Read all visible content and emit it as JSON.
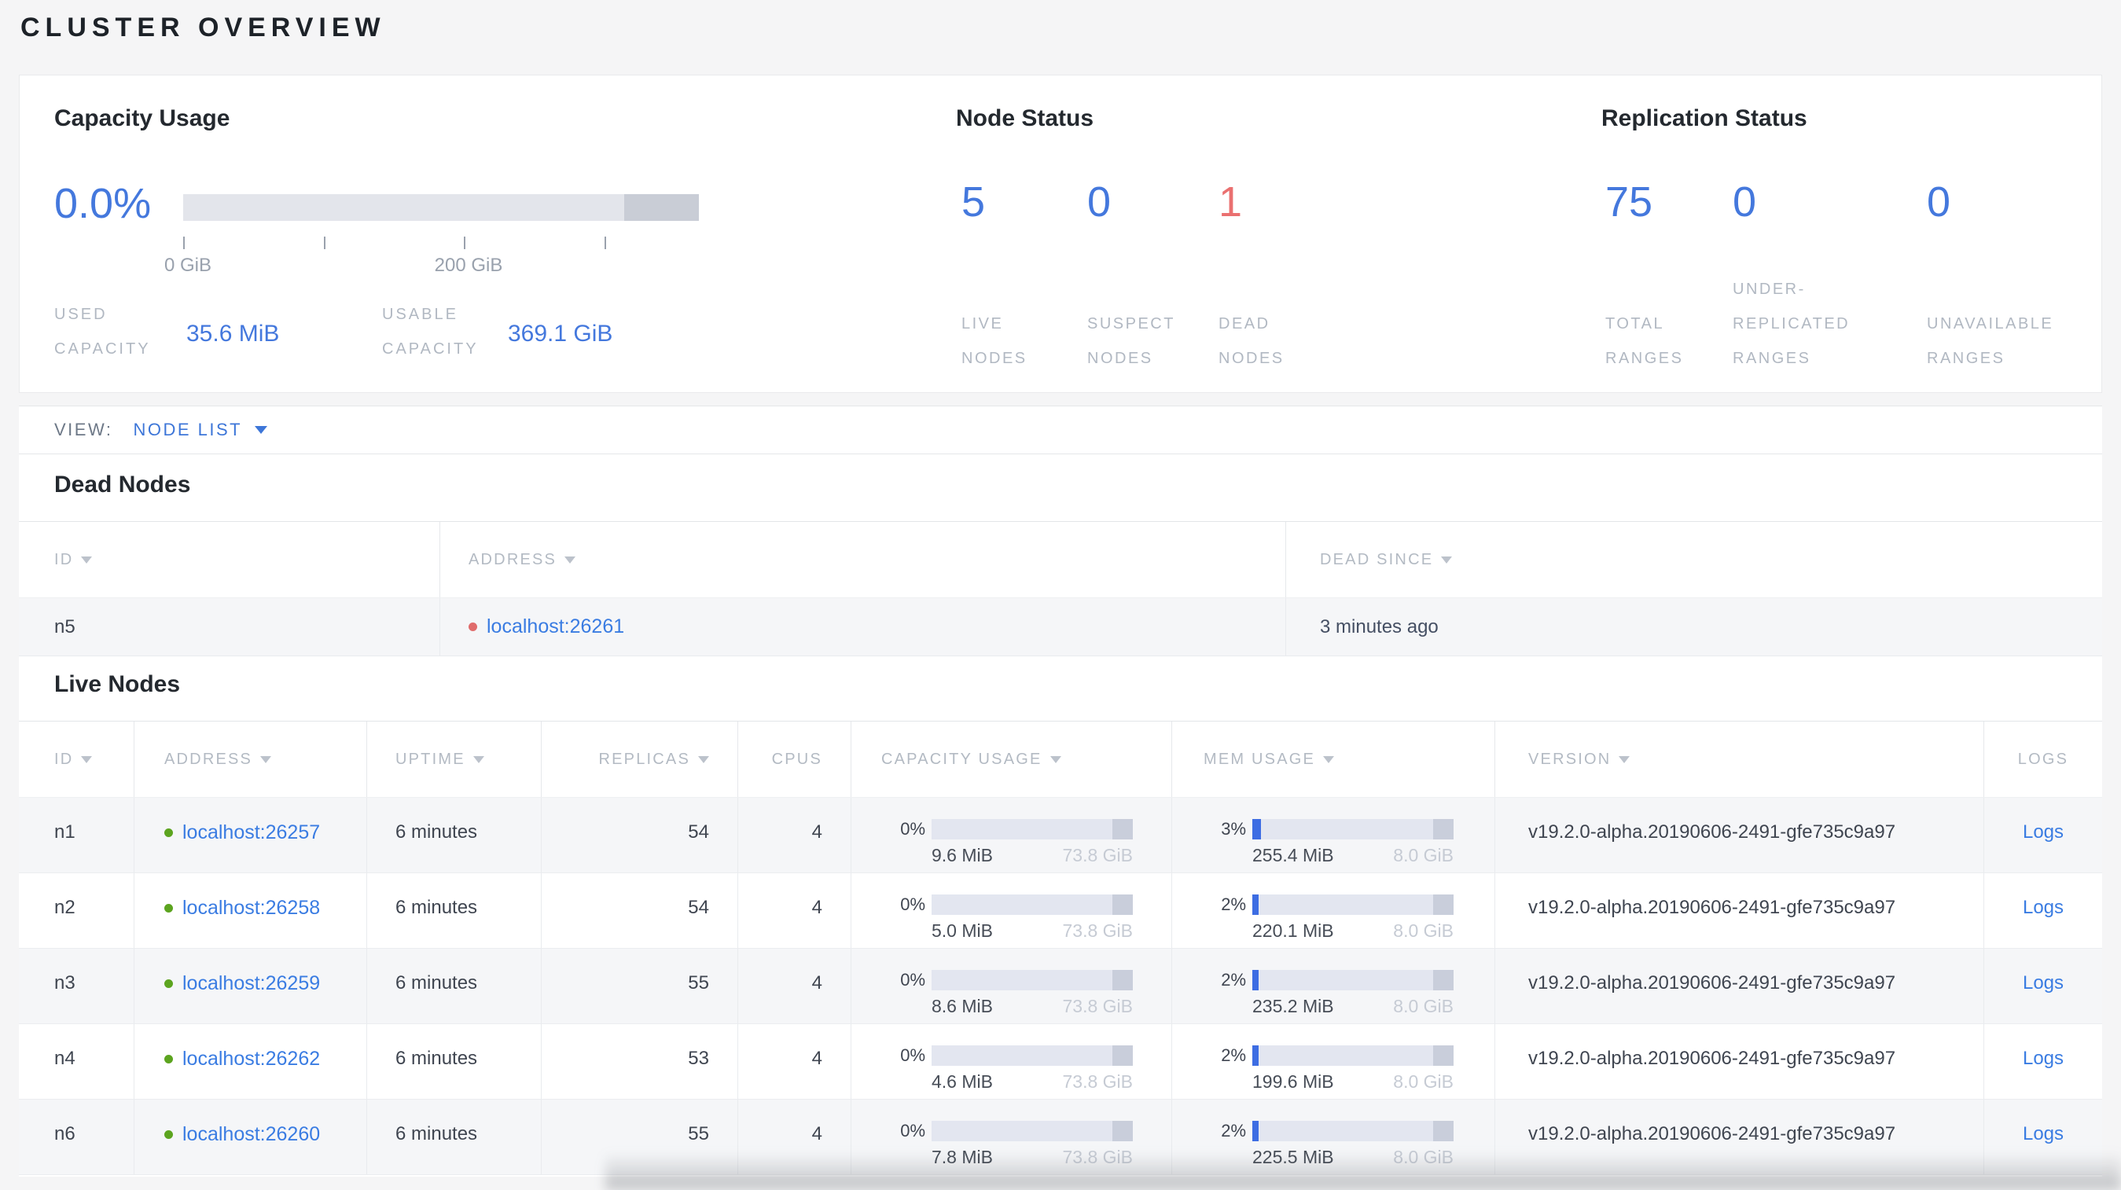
{
  "page_title": "CLUSTER OVERVIEW",
  "summary": {
    "capacity": {
      "title": "Capacity Usage",
      "percent": "0.0%",
      "tick_labels": [
        "0 GiB",
        "200 GiB"
      ],
      "used_label": "USED\nCAPACITY",
      "used_value": "35.6 MiB",
      "usable_label": "USABLE\nCAPACITY",
      "usable_value": "369.1 GiB"
    },
    "node_status": {
      "title": "Node Status",
      "stats": [
        {
          "value": "5",
          "label": "LIVE\nNODES",
          "color": "blue"
        },
        {
          "value": "0",
          "label": "SUSPECT\nNODES",
          "color": "blue"
        },
        {
          "value": "1",
          "label": "DEAD\nNODES",
          "color": "red"
        }
      ]
    },
    "replication": {
      "title": "Replication Status",
      "stats": [
        {
          "value": "75",
          "label": "TOTAL\nRANGES",
          "color": "blue"
        },
        {
          "value": "0",
          "label": "UNDER-\nREPLICATED\nRANGES",
          "color": "blue"
        },
        {
          "value": "0",
          "label": "UNAVAILABLE\nRANGES",
          "color": "blue"
        }
      ]
    }
  },
  "view_bar": {
    "label": "VIEW:",
    "selected": "NODE LIST"
  },
  "dead_nodes": {
    "title": "Dead Nodes",
    "columns": [
      "ID",
      "ADDRESS",
      "DEAD SINCE"
    ],
    "rows": [
      {
        "id": "n5",
        "address": "localhost:26261",
        "dead_since": "3 minutes ago"
      }
    ]
  },
  "live_nodes": {
    "title": "Live Nodes",
    "columns": [
      "ID",
      "ADDRESS",
      "UPTIME",
      "REPLICAS",
      "CPUS",
      "CAPACITY USAGE",
      "MEM USAGE",
      "VERSION",
      "LOGS"
    ],
    "rows": [
      {
        "id": "n1",
        "address": "localhost:26257",
        "uptime": "6 minutes",
        "replicas": "54",
        "cpus": "4",
        "capacity": {
          "percent": "0%",
          "fill_pct": 0,
          "used": "9.6 MiB",
          "total": "73.8 GiB"
        },
        "memory": {
          "percent": "3%",
          "fill_pct": 3,
          "used": "255.4 MiB",
          "total": "8.0 GiB"
        },
        "version": "v19.2.0-alpha.20190606-2491-gfe735c9a97",
        "logs_label": "Logs"
      },
      {
        "id": "n2",
        "address": "localhost:26258",
        "uptime": "6 minutes",
        "replicas": "54",
        "cpus": "4",
        "capacity": {
          "percent": "0%",
          "fill_pct": 0,
          "used": "5.0 MiB",
          "total": "73.8 GiB"
        },
        "memory": {
          "percent": "2%",
          "fill_pct": 2,
          "used": "220.1 MiB",
          "total": "8.0 GiB"
        },
        "version": "v19.2.0-alpha.20190606-2491-gfe735c9a97",
        "logs_label": "Logs"
      },
      {
        "id": "n3",
        "address": "localhost:26259",
        "uptime": "6 minutes",
        "replicas": "55",
        "cpus": "4",
        "capacity": {
          "percent": "0%",
          "fill_pct": 0,
          "used": "8.6 MiB",
          "total": "73.8 GiB"
        },
        "memory": {
          "percent": "2%",
          "fill_pct": 2,
          "used": "235.2 MiB",
          "total": "8.0 GiB"
        },
        "version": "v19.2.0-alpha.20190606-2491-gfe735c9a97",
        "logs_label": "Logs"
      },
      {
        "id": "n4",
        "address": "localhost:26262",
        "uptime": "6 minutes",
        "replicas": "53",
        "cpus": "4",
        "capacity": {
          "percent": "0%",
          "fill_pct": 0,
          "used": "4.6 MiB",
          "total": "73.8 GiB"
        },
        "memory": {
          "percent": "2%",
          "fill_pct": 2,
          "used": "199.6 MiB",
          "total": "8.0 GiB"
        },
        "version": "v19.2.0-alpha.20190606-2491-gfe735c9a97",
        "logs_label": "Logs"
      },
      {
        "id": "n6",
        "address": "localhost:26260",
        "uptime": "6 minutes",
        "replicas": "55",
        "cpus": "4",
        "capacity": {
          "percent": "0%",
          "fill_pct": 0,
          "used": "7.8 MiB",
          "total": "73.8 GiB"
        },
        "memory": {
          "percent": "2%",
          "fill_pct": 2,
          "used": "225.5 MiB",
          "total": "8.0 GiB"
        },
        "version": "v19.2.0-alpha.20190606-2491-gfe735c9a97",
        "logs_label": "Logs"
      }
    ]
  },
  "colors": {
    "accent_blue": "#4478dd",
    "link_blue": "#3a7ce2",
    "alert_red": "#ea7070",
    "green_dot": "#5ca41f",
    "red_dot": "#e06c6c",
    "bar_track": "#e3e6f0",
    "bar_dark": "#c9cedb",
    "bar_fill_blue": "#3d6de3"
  }
}
